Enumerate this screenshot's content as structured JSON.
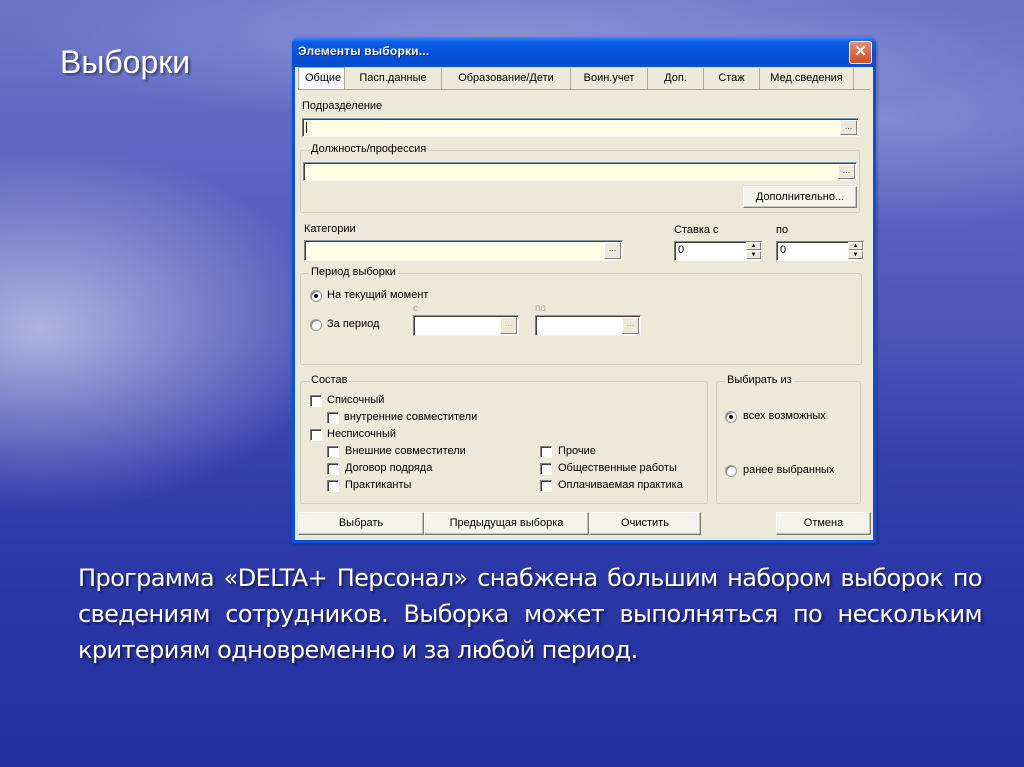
{
  "slide": {
    "title": "Выборки",
    "body": "Программа «DELTA+ Персонал» снабжена большим набором выборок по сведениям сотрудников. Выборка может выполняться по нескольким критериям одновременно и за любой период."
  },
  "dialog": {
    "title": "Элементы выборки...",
    "close_icon": "close-icon",
    "tabs": [
      {
        "label": "Общие",
        "active": true
      },
      {
        "label": "Пасп.данные",
        "active": false
      },
      {
        "label": "Образование/Дети",
        "active": false
      },
      {
        "label": "Воин.учет",
        "active": false
      },
      {
        "label": "Доп.",
        "active": false
      },
      {
        "label": "Стаж",
        "active": false
      },
      {
        "label": "Мед.сведения",
        "active": false
      }
    ],
    "general": {
      "division_label": "Подразделение",
      "division_value": "",
      "position_group": "Должность/профессия",
      "position_value": "",
      "more_button": "Дополнительно...",
      "category_label": "Категории",
      "category_value": "",
      "ellipsis": "...",
      "rate_from_label": "Ставка с",
      "rate_from_value": "0",
      "rate_to_label": "по",
      "rate_to_value": "0",
      "period_group": "Период выборки",
      "period_options": [
        {
          "label": "На текущий момент",
          "selected": true
        },
        {
          "label": "За период",
          "selected": false
        }
      ],
      "period_from_label": "с",
      "period_to_label": "по",
      "period_from_value": "",
      "period_to_value": "",
      "composition_group": "Состав",
      "composition_items": [
        {
          "label": "Списочный",
          "checked": false
        },
        {
          "label": "внутренние совместители",
          "checked": false
        },
        {
          "label": "Несписочный",
          "checked": false
        },
        {
          "label": "Внешние совместители",
          "checked": false
        },
        {
          "label": "Договор подряда",
          "checked": false
        },
        {
          "label": "Практиканты",
          "checked": false
        },
        {
          "label": "Прочие",
          "checked": false
        },
        {
          "label": "Общественные работы",
          "checked": false
        },
        {
          "label": "Оплачиваемая практика",
          "checked": false
        }
      ],
      "choose_from_group": "Выбирать из",
      "choose_from_options": [
        {
          "label": "всех возможных",
          "selected": true
        },
        {
          "label": "ранее выбранных",
          "selected": false
        }
      ]
    },
    "buttons": {
      "select": "Выбрать",
      "previous": "Предыдущая выборка",
      "clear": "Очистить",
      "cancel": "Отмена"
    }
  }
}
